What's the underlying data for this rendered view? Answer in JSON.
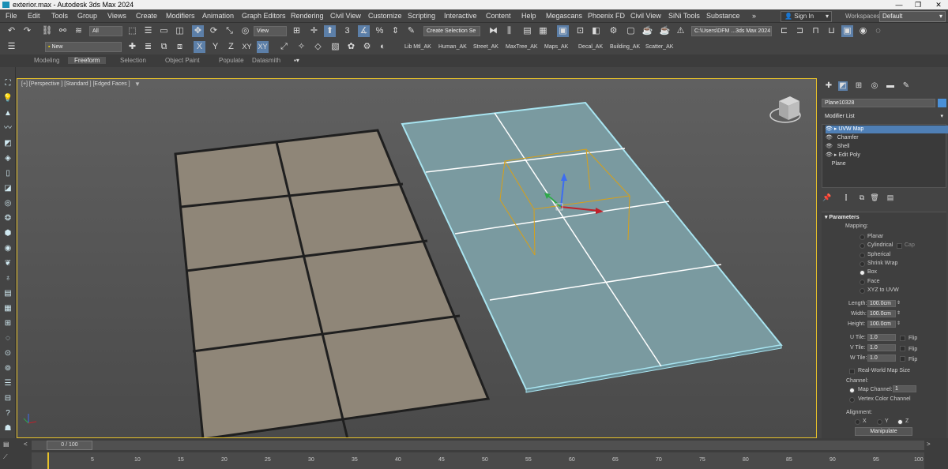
{
  "window": {
    "title": "exterior.max - Autodesk 3ds Max 2024",
    "minimize": "—",
    "maximize": "❐",
    "close": "✕"
  },
  "menu": [
    "File",
    "Edit",
    "Tools",
    "Group",
    "Views",
    "Create",
    "Modifiers",
    "Animation",
    "Graph Editors",
    "Rendering",
    "Civil View",
    "Customize",
    "Scripting",
    "Interactive",
    "Content",
    "Help",
    "Megascans",
    "Phoenix FD",
    "Civil View",
    "SiNi Tools",
    "Substance",
    "»"
  ],
  "signin": {
    "label": "Sign In"
  },
  "workspaces": {
    "label": "Workspaces:",
    "value": "Default"
  },
  "toolbar1": {
    "filter_value": "All",
    "view_value": "View",
    "selection_set_placeholder": "Create Selection Se",
    "path_value": "C:\\Users\\DFM ...3ds Max 2024"
  },
  "toolbar2": {
    "layer_value": "New",
    "axis_x": "X",
    "axis_y": "Y",
    "axis_z": "Z",
    "axis_xy": "XY",
    "axis_xy2": "XY",
    "custom_tabs": [
      "Lib Mtl_AK",
      "Human_AK",
      "Street_AK",
      "MaxTree_AK",
      "Maps_AK",
      "Decal_AK",
      "Building_AK",
      "Scatter_AK"
    ]
  },
  "ribbon": {
    "tabs": [
      "Modeling",
      "Freeform",
      "Selection",
      "Object Paint",
      "Populate",
      "Datasmith"
    ],
    "active": "Freeform"
  },
  "viewport": {
    "label": "[+] [Perspective ] [Standard ] [Edged Faces ]"
  },
  "command_panel": {
    "object_name": "Plane10328",
    "modifier_list": "Modifier List",
    "stack": [
      {
        "label": "UVW Map",
        "selected": true,
        "expand": true
      },
      {
        "label": "Chamfer",
        "selected": false,
        "expand": false
      },
      {
        "label": "Shell",
        "selected": false,
        "expand": false
      },
      {
        "label": "Edit Poly",
        "selected": false,
        "expand": true
      },
      {
        "label": "Plane",
        "selected": false,
        "expand": false
      }
    ],
    "parameters": {
      "header": "Parameters",
      "mapping_label": "Mapping:",
      "mapping_options": [
        "Planar",
        "Cylindrical",
        "Spherical",
        "Shrink Wrap",
        "Box",
        "Face",
        "XYZ to UVW"
      ],
      "mapping_selected": "Box",
      "cap_label": "Cap",
      "length_label": "Length:",
      "length_value": "100.0cm",
      "width_label": "Width:",
      "width_value": "100.0cm",
      "height_label": "Height:",
      "height_value": "100.0cm",
      "utile_label": "U Tile:",
      "utile_value": "1.0",
      "vtile_label": "V Tile:",
      "vtile_value": "1.0",
      "wtile_label": "W Tile:",
      "wtile_value": "1.0",
      "flip_label": "Flip",
      "realworld_label": "Real-World Map Size",
      "channel_label": "Channel:",
      "map_channel_label": "Map Channel:",
      "map_channel_value": "1",
      "vertex_color_label": "Vertex Color Channel",
      "alignment_label": "Alignment:",
      "align_x": "X",
      "align_y": "Y",
      "align_z": "Z",
      "align_selected": "Z",
      "manipulate_label": "Manipulate"
    }
  },
  "timeline": {
    "frame_display": "0 / 100",
    "ticks": [
      "5",
      "10",
      "15",
      "20",
      "25",
      "30",
      "35",
      "40",
      "45",
      "50",
      "55",
      "60",
      "65",
      "70",
      "75",
      "80",
      "85",
      "90",
      "95",
      "100"
    ]
  },
  "colors": {
    "selection_accent": "#4f7fb5",
    "viewport_border": "#e6c12a",
    "selected_wire": "#a8e4f0"
  }
}
